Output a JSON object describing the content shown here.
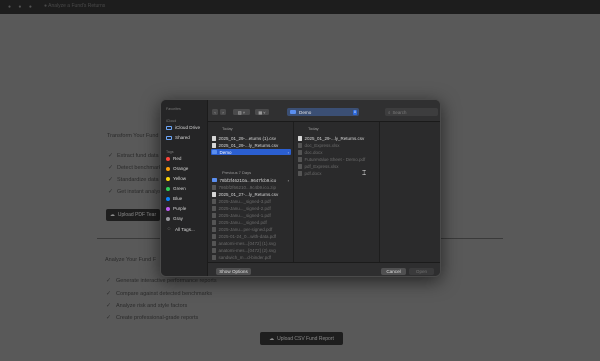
{
  "browser": {
    "title": "● Analyze a Fund's Returns"
  },
  "background": {
    "section1_title": "Transform Your Fund",
    "section1_items": [
      "Extract fund data",
      "Detect benchmarks",
      "Standardize data",
      "Get instant analysis"
    ],
    "upload_pdf_label": "Upload PDF Tear",
    "section2_title": "Analyze Your Fund F",
    "section2_items": [
      "Generate interactive performance reports",
      "Compare against detected benchmarks",
      "Analyze risk and style factors",
      "Create professional-grade reports"
    ],
    "upload_csv_label": "Upload CSV Fund Report"
  },
  "dialog": {
    "sidebar": {
      "favorites_header": "Favorites",
      "icloud_header": "iCloud",
      "icloud_items": [
        "iCloud Drive",
        "Shared"
      ],
      "tags_header": "Tags",
      "tags": [
        {
          "label": "Red",
          "color": "#ff453a"
        },
        {
          "label": "Orange",
          "color": "#ff9f0a"
        },
        {
          "label": "Yellow",
          "color": "#ffd60a"
        },
        {
          "label": "Green",
          "color": "#30d158"
        },
        {
          "label": "Blue",
          "color": "#0a84ff"
        },
        {
          "label": "Purple",
          "color": "#bf5af2"
        },
        {
          "label": "Gray",
          "color": "#98989d"
        }
      ],
      "all_tags": "All Tags..."
    },
    "toolbar": {
      "back_icon": "chevron-left-icon",
      "forward_icon": "chevron-right-icon",
      "view_icon": "columns-view-icon",
      "grid_icon": "grid-view-icon",
      "location": "Demo",
      "search_placeholder": "Search"
    },
    "column1": {
      "today_header": "Today",
      "today_items": [
        {
          "name": "2025_01_29-...eturns (1).csv",
          "kind": "file",
          "dim": false
        },
        {
          "name": "2025_01_29-...ly_Returns.csv",
          "kind": "file",
          "dim": false
        },
        {
          "name": "Demo",
          "kind": "folder",
          "dim": false,
          "selected": true
        }
      ],
      "prev7_header": "Previous 7 Days",
      "prev7_items": [
        {
          "name": "78bf2f46210a...9647fcb9.ico",
          "kind": "folder",
          "dim": false
        },
        {
          "name": "786bf2f66210...9c4b9.ico.zip",
          "kind": "file",
          "dim": true
        },
        {
          "name": "2025_01_27-...ly_Returns.csv",
          "kind": "file",
          "dim": false
        },
        {
          "name": "2025-Janu..._signed-3.pdf",
          "kind": "file",
          "dim": true
        },
        {
          "name": "2025-Janu..._signed-2.pdf",
          "kind": "file",
          "dim": true
        },
        {
          "name": "2025-Janu..._signed-1.pdf",
          "kind": "file",
          "dim": true
        },
        {
          "name": "2025-Janu..._signed.pdf",
          "kind": "file",
          "dim": true
        },
        {
          "name": "2025-Janu...per-signed.pdf",
          "kind": "file",
          "dim": true
        },
        {
          "name": "2025-01-24_0...with-data.pdf",
          "kind": "file",
          "dim": true
        },
        {
          "name": "anatomi-mes...[0472] (1).svg",
          "kind": "file",
          "dim": true
        },
        {
          "name": "anatomi-mes...[0472] (2).svg",
          "kind": "file",
          "dim": true
        },
        {
          "name": "sandwich_m...d-binder.pdf",
          "kind": "file",
          "dim": true
        }
      ]
    },
    "column2": {
      "today_header": "Today",
      "items": [
        {
          "name": "2025_01_29-...ly_Returns.csv",
          "dim": false
        },
        {
          "name": "doc_Express.xlsx",
          "dim": true
        },
        {
          "name": "doc.docx",
          "dim": true
        },
        {
          "name": "FutureValue Sheet - Demo.pdf",
          "dim": true
        },
        {
          "name": "pdf_Express.xlsx",
          "dim": true
        },
        {
          "name": "pdf.docx",
          "dim": true
        }
      ]
    },
    "buttons": {
      "show_options": "Show Options",
      "cancel": "Cancel",
      "open": "Open"
    }
  }
}
